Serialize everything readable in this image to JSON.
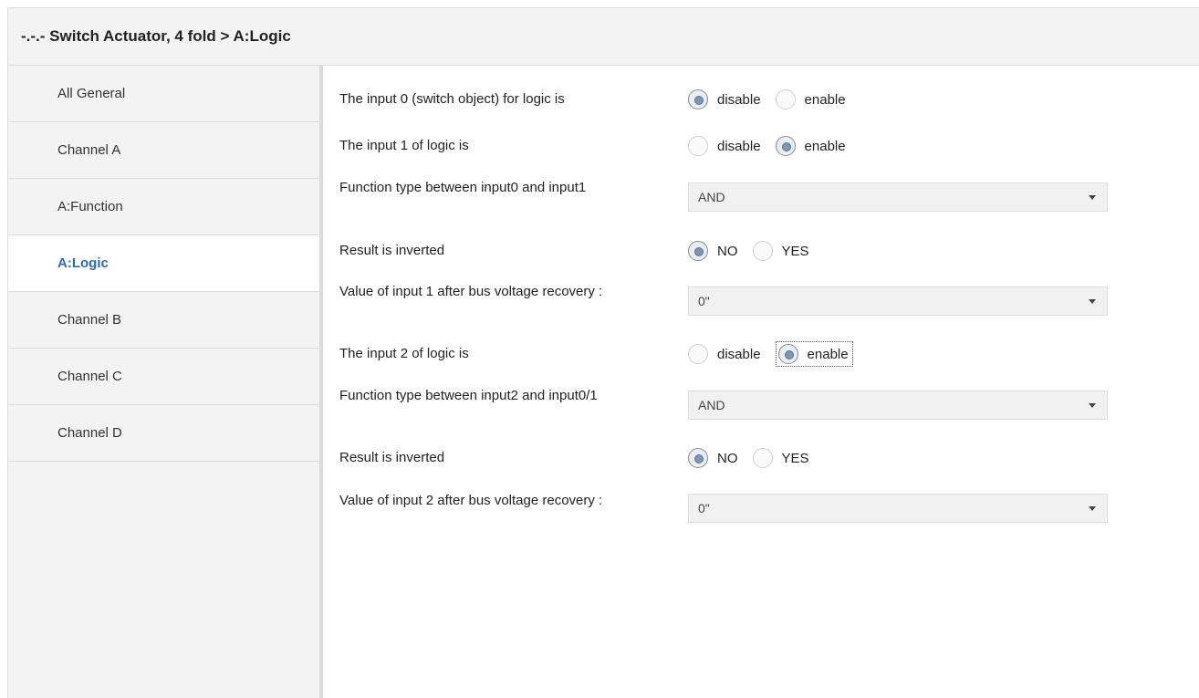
{
  "window": {
    "title": "-.-.- Switch Actuator, 4 fold > A:Logic"
  },
  "sidebar": {
    "items": [
      {
        "label": "All General"
      },
      {
        "label": "Channel A"
      },
      {
        "label": "A:Function"
      },
      {
        "label": "A:Logic",
        "active": true
      },
      {
        "label": "Channel B"
      },
      {
        "label": "Channel C"
      },
      {
        "label": "Channel D"
      }
    ]
  },
  "params": {
    "input0": {
      "label": "The input 0 (switch object) for logic is",
      "options": [
        "disable",
        "enable"
      ],
      "selected": "disable"
    },
    "input1": {
      "label": "The input 1 of logic is",
      "options": [
        "disable",
        "enable"
      ],
      "selected": "enable"
    },
    "func01": {
      "label": "Function type between input0 and input1",
      "value": "AND"
    },
    "inv1": {
      "label": "Result is inverted",
      "options": [
        "NO",
        "YES"
      ],
      "selected": "NO"
    },
    "val1": {
      "label": "Value of input 1 after bus voltage recovery :",
      "value": "0\""
    },
    "input2": {
      "label": "The input 2 of logic is",
      "options": [
        "disable",
        "enable"
      ],
      "selected": "enable"
    },
    "func2": {
      "label": "Function type between input2 and input0/1",
      "value": "AND"
    },
    "inv2": {
      "label": "Result is inverted",
      "options": [
        "NO",
        "YES"
      ],
      "selected": "NO"
    },
    "val2": {
      "label": "Value of input 2 after bus voltage recovery :",
      "value": "0\""
    }
  },
  "colors": {
    "active_nav": "#2b6cb0",
    "panel_bg": "#f3f3f3",
    "select_bg": "#f1f1f1"
  },
  "icons": {
    "select_caret": "caret-down-icon",
    "radio": "radio-icon"
  }
}
